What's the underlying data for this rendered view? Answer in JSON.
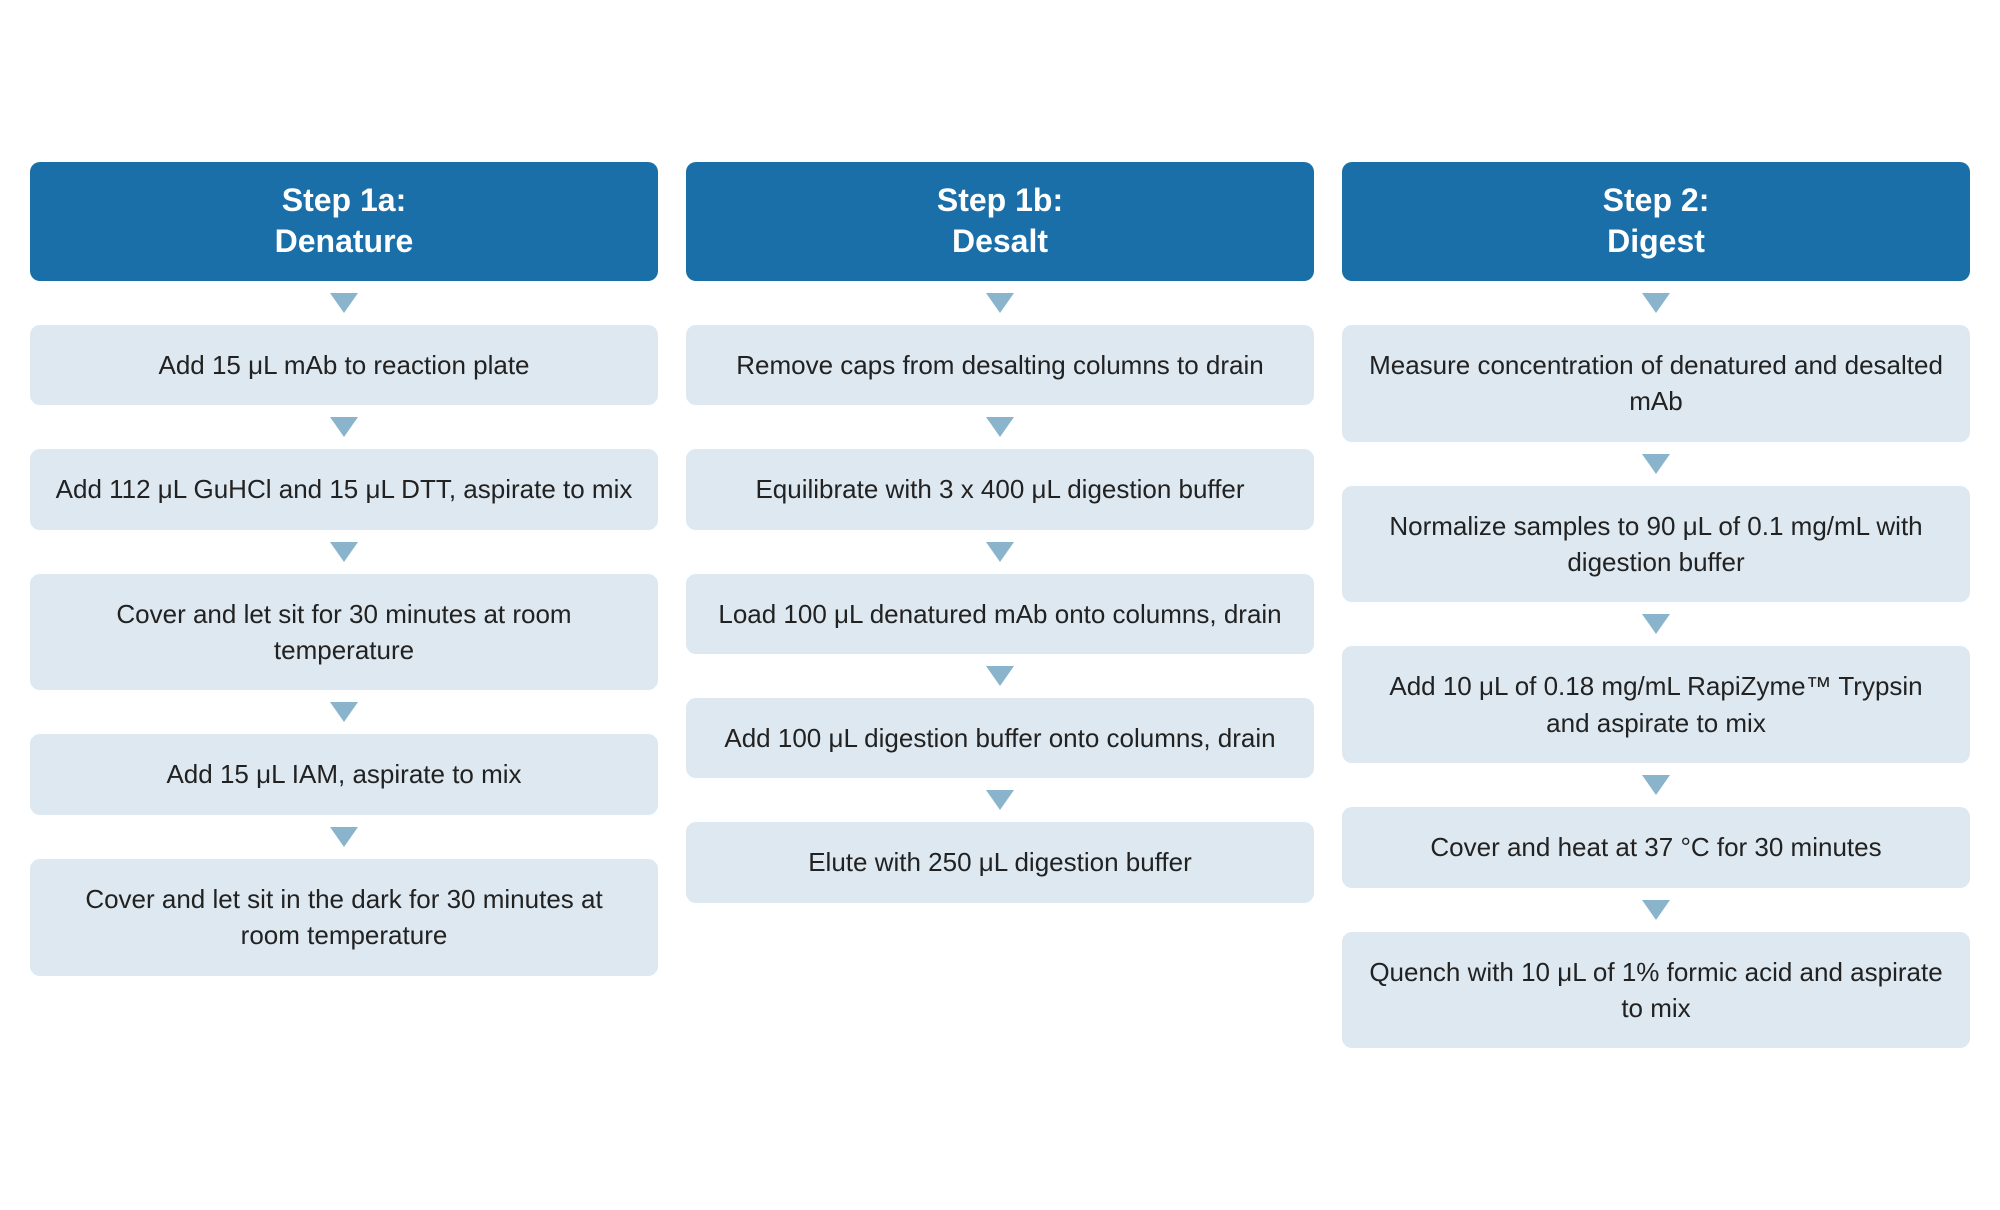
{
  "columns": [
    {
      "id": "step1a",
      "header_line1": "Step 1a:",
      "header_line2": "Denature",
      "steps": [
        "Add 15 μL mAb to reaction plate",
        "Add 112 μL GuHCl and 15 μL DTT, aspirate to mix",
        "Cover and let sit for 30 minutes at room temperature",
        "Add 15 μL IAM, aspirate to mix",
        "Cover and let sit in the dark for 30 minutes at room temperature"
      ]
    },
    {
      "id": "step1b",
      "header_line1": "Step 1b:",
      "header_line2": "Desalt",
      "steps": [
        "Remove caps from desalting columns to drain",
        "Equilibrate with 3 x 400 μL digestion buffer",
        "Load 100 μL denatured mAb onto columns, drain",
        "Add 100 μL digestion buffer onto columns, drain",
        "Elute with 250 μL digestion buffer"
      ]
    },
    {
      "id": "step2",
      "header_line1": "Step 2:",
      "header_line2": "Digest",
      "steps": [
        "Measure concentration of denatured and desalted mAb",
        "Normalize samples to 90 μL of 0.1 mg/mL with digestion buffer",
        "Add 10 μL of 0.18 mg/mL RapiZyme™ Trypsin and aspirate to mix",
        "Cover and heat at 37 °C for 30 minutes",
        "Quench with 10 μL of 1% formic acid and aspirate to mix"
      ]
    }
  ]
}
